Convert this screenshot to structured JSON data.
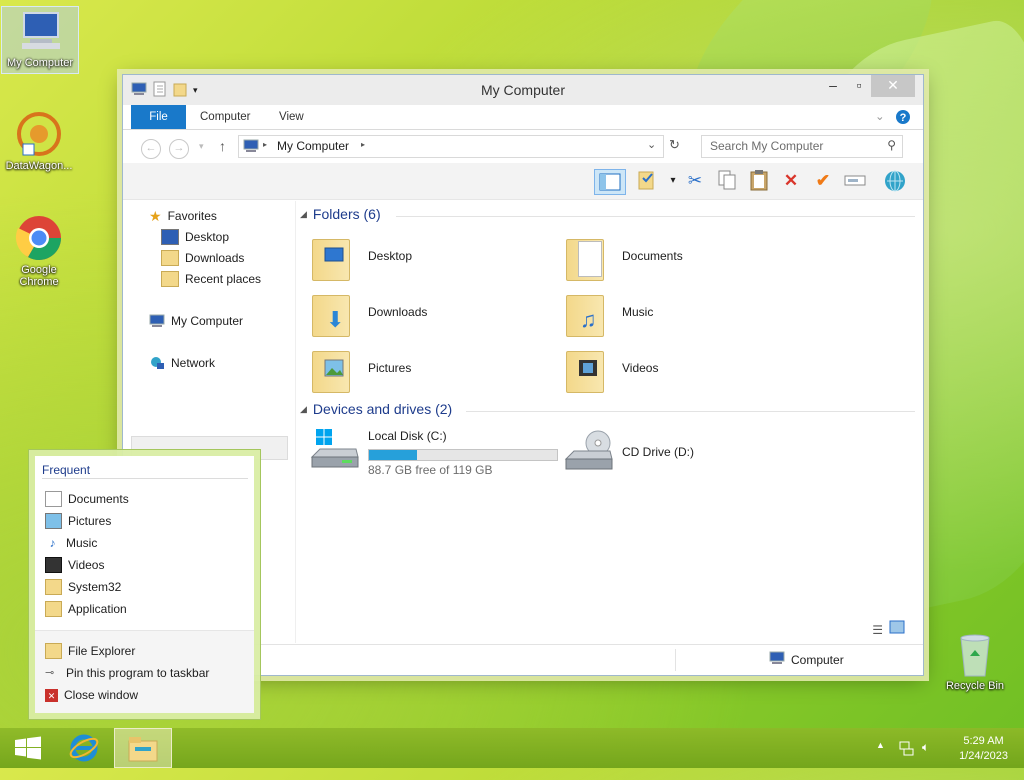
{
  "desktop": {
    "icons": [
      {
        "label": "My Computer"
      },
      {
        "label": "DataWagon..."
      },
      {
        "label": "Google Chrome"
      },
      {
        "label": "Recycle Bin"
      }
    ]
  },
  "window": {
    "title": "My Computer",
    "tabs": [
      "File",
      "Computer",
      "View"
    ],
    "address": {
      "path": "My Computer"
    },
    "search": {
      "placeholder": "Search My Computer"
    },
    "nav": {
      "favorites": "Favorites",
      "desktop": "Desktop",
      "downloads": "Downloads",
      "recent": "Recent places",
      "computer": "My Computer",
      "network": "Network"
    },
    "folders_header": "Folders (6)",
    "folders": [
      {
        "name": "Desktop"
      },
      {
        "name": "Documents"
      },
      {
        "name": "Downloads"
      },
      {
        "name": "Music"
      },
      {
        "name": "Pictures"
      },
      {
        "name": "Videos"
      }
    ],
    "drives_header": "Devices and drives (2)",
    "drives": [
      {
        "name": "Local Disk (C:)",
        "free": "88.7 GB free of 119 GB",
        "used_fraction": 0.2546
      },
      {
        "name": "CD Drive (D:)"
      }
    ],
    "status": {
      "location": "Computer"
    }
  },
  "jumplist": {
    "header": "Frequent",
    "items": [
      "Documents",
      "Pictures",
      "Music",
      "Videos",
      "System32",
      "Application"
    ],
    "actions": [
      "File Explorer",
      "Pin this program to taskbar",
      "Close window"
    ]
  },
  "taskbar": {
    "time": "5:29 AM",
    "date": "1/24/2023"
  },
  "colors": {
    "accent": "#1979ca",
    "progress": "#26a0da",
    "group_header": "#1e3c8c"
  }
}
